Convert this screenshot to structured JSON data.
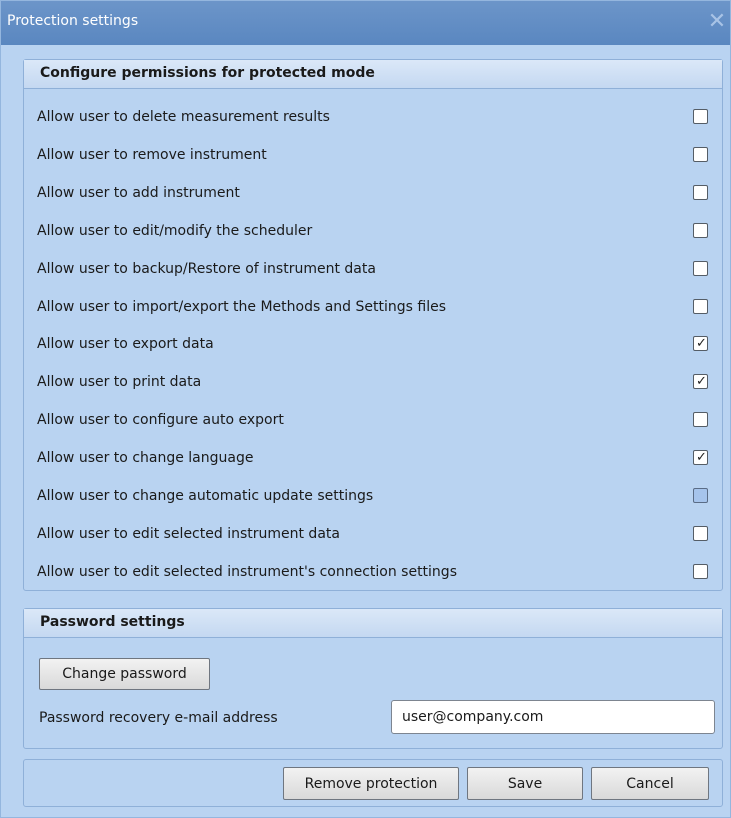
{
  "window": {
    "title": "Protection settings",
    "close_glyph": "✕"
  },
  "permissions": {
    "header": "Configure permissions for protected mode",
    "items": [
      {
        "label": "Allow user to delete measurement results",
        "state": "unchecked"
      },
      {
        "label": "Allow user to remove instrument",
        "state": "unchecked"
      },
      {
        "label": "Allow user to add instrument",
        "state": "unchecked"
      },
      {
        "label": "Allow user to edit/modify the scheduler",
        "state": "unchecked"
      },
      {
        "label": "Allow user to backup/Restore of instrument data",
        "state": "unchecked"
      },
      {
        "label": "Allow user to import/export the Methods and Settings files",
        "state": "unchecked"
      },
      {
        "label": "Allow user to export data",
        "state": "checked"
      },
      {
        "label": "Allow user to print data",
        "state": "checked"
      },
      {
        "label": "Allow user to configure auto export",
        "state": "unchecked"
      },
      {
        "label": "Allow user to change language",
        "state": "checked"
      },
      {
        "label": "Allow user to change automatic update settings",
        "state": "indeterminate"
      },
      {
        "label": "Allow user to edit selected instrument data",
        "state": "unchecked"
      },
      {
        "label": "Allow user to edit selected instrument's connection settings",
        "state": "unchecked"
      }
    ]
  },
  "password": {
    "header": "Password settings",
    "change_button": "Change password",
    "recovery_label": "Password recovery e-mail address",
    "recovery_email": "user@company.com"
  },
  "footer": {
    "remove_button": "Remove protection",
    "save_button": "Save",
    "cancel_button": "Cancel"
  },
  "colors": {
    "titlebar": "#5a87c0",
    "dialog_bg": "#b9d3f1",
    "group_border": "#8fb0d8"
  }
}
